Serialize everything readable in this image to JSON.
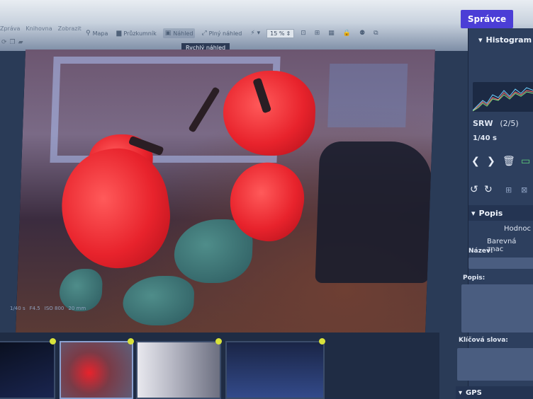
{
  "menus": [
    "Zpráva",
    "Knihovna",
    "Zobrazit"
  ],
  "admin_button": "Správce",
  "toolbar": {
    "map": "Mapa",
    "explorer": "Průzkumník",
    "preview": "Náhled",
    "fullview": "Plný náhled",
    "zoom": "15 %"
  },
  "tooltip": "Rychlý náhled",
  "exif": [
    "1/40 s",
    "F4.5",
    "ISO 800",
    "20 mm"
  ],
  "side": {
    "histogram": "Histogram",
    "format": "SRW",
    "index": "(2/5)",
    "shutter": "1/40 s",
    "popis_section": "Popis",
    "rating": "Hodnoc",
    "color_tag": "Barevná znac",
    "name_label": "Název:",
    "desc_label": "Popis:",
    "keywords_label": "Klíčová slova:",
    "gps_section": "GPS"
  },
  "icons": {
    "map": "map-pin-icon",
    "explorer": "folder-icon",
    "preview": "image-icon",
    "fullview": "expand-icon"
  },
  "colors": {
    "accent": "#4b3ed6",
    "panel": "#2d3f5e",
    "badge": "#d9e23b"
  }
}
